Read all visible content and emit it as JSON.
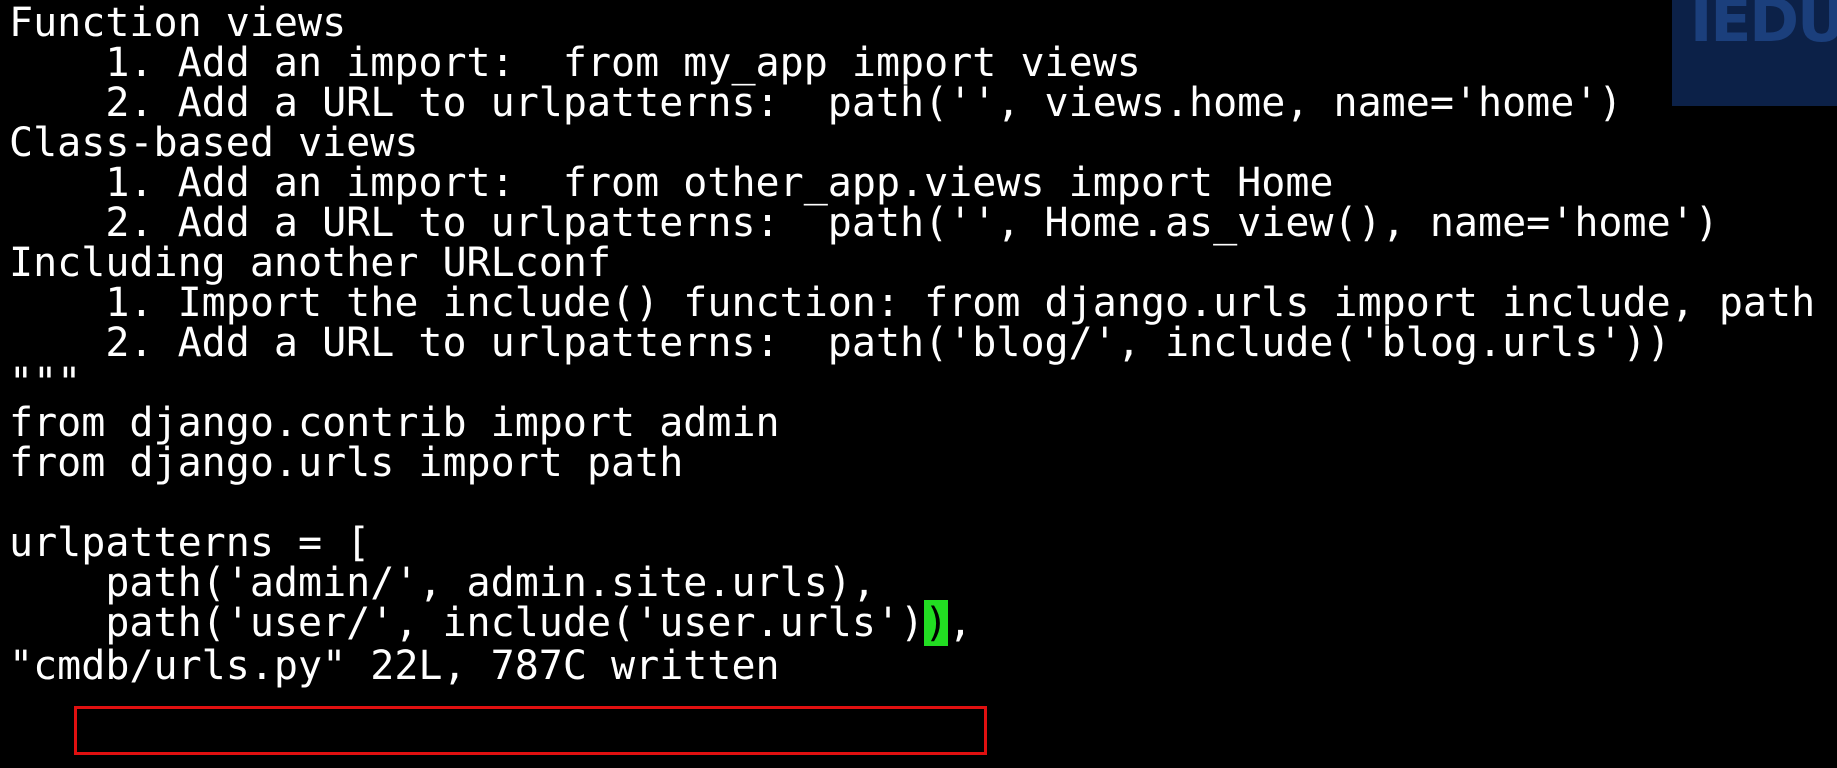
{
  "terminal": {
    "lines": [
      "Function views",
      "    1. Add an import:  from my_app import views",
      "    2. Add a URL to urlpatterns:  path('', views.home, name='home')",
      "Class-based views",
      "    1. Add an import:  from other_app.views import Home",
      "    2. Add a URL to urlpatterns:  path('', Home.as_view(), name='home')",
      "Including another URLconf",
      "    1. Import the include() function: from django.urls import include, path",
      "    2. Add a URL to urlpatterns:  path('blog/', include('blog.urls'))",
      "\"\"\"",
      "from django.contrib import admin",
      "from django.urls import path",
      "",
      "urlpatterns = [",
      "    path('admin/', admin.site.urls),"
    ],
    "cursor_line": {
      "before": "    path('user/', include('user.urls')",
      "cursor_char": ")",
      "after": ","
    },
    "status_line": "\"cmdb/urls.py\" 22L, 787C written",
    "cursor_color": "#22dd22",
    "highlight_color": "#e01010"
  },
  "watermark": {
    "text": "IEDU"
  }
}
